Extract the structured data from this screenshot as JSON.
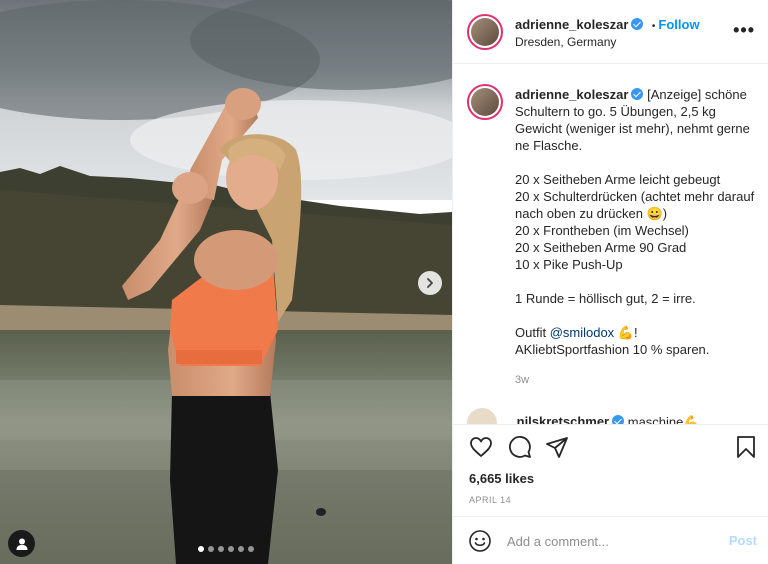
{
  "header": {
    "username": "adrienne_koleszar",
    "location": "Dresden, Germany",
    "follow_label": "Follow",
    "separator": "•"
  },
  "caption": {
    "username": "adrienne_koleszar",
    "lines": [
      "[Anzeige] schöne Schultern to go. 5 Übungen, 2,5 kg Gewicht (weniger ist mehr), nehmt gerne ne Flasche.",
      "",
      "20 x Seitheben Arme leicht gebeugt",
      "20 x Schulterdrücken (achtet mehr darauf nach oben zu drücken 😀)",
      "20 x Frontheben (im Wechsel)",
      "20 x Seitheben Arme 90 Grad",
      "10 x Pike Push-Up",
      "",
      "1 Runde = höllisch gut, 2 = irre.",
      ""
    ],
    "outfit_prefix": "Outfit ",
    "outfit_mention": "@smilodox",
    "outfit_suffix": " 💪!",
    "outfit_line2": "AKliebtSportfashion 10 % sparen.",
    "time_ago": "3w"
  },
  "next_comment": {
    "username": "nilskretschmer",
    "text": "maschine💪"
  },
  "engagement": {
    "likes": "6,665 likes",
    "date": "APRIL 14"
  },
  "comment_box": {
    "placeholder": "Add a comment...",
    "post_label": "Post"
  },
  "carousel": {
    "total_slides": 6,
    "active_slide": 1
  },
  "colors": {
    "accent": "#0095f6",
    "post_disabled": "#b3dbff",
    "verified": "#3897f0",
    "muted": "#8e8e8e",
    "sports_bra": "#f07a4a"
  },
  "icons": [
    "more-options-icon",
    "verified-badge-icon",
    "heart-icon",
    "comment-icon",
    "share-icon",
    "bookmark-icon",
    "emoji-icon",
    "chevron-right-icon",
    "user-tag-icon"
  ]
}
